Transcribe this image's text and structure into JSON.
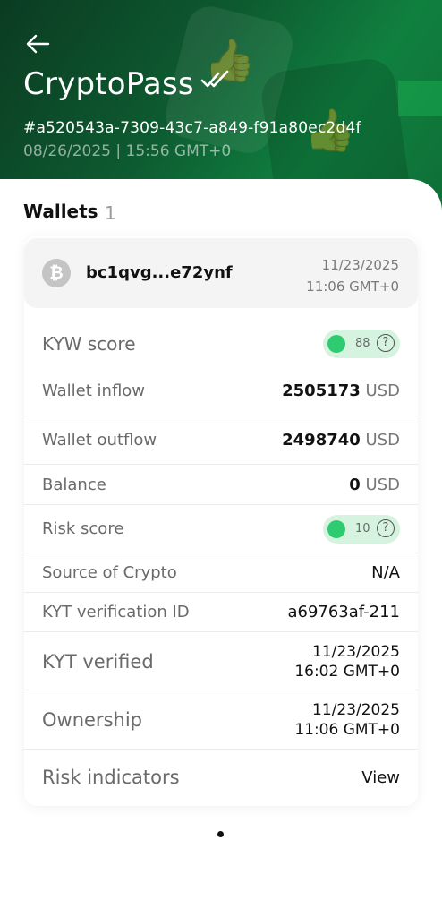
{
  "header": {
    "title": "CryptoPass",
    "hash": "#a520543a-7309-43c7-a849-f91a80ec2d4f",
    "timestamp": "08/26/2025 | 15:56 GMT+0"
  },
  "wallets": {
    "title": "Wallets",
    "count": "1",
    "item": {
      "icon": "bitcoin-icon",
      "icon_glyph": "₿",
      "address": "bc1qvg...e72ynf",
      "date": "11/23/2025",
      "time": "11:06 GMT+0"
    }
  },
  "details": {
    "kyw_score": {
      "label": "KYW score",
      "value": "88",
      "help": "?"
    },
    "inflow": {
      "label": "Wallet inflow",
      "amount": "2505173",
      "unit": "USD"
    },
    "outflow": {
      "label": "Wallet outflow",
      "amount": "2498740",
      "unit": "USD"
    },
    "balance": {
      "label": "Balance",
      "amount": "0",
      "unit": "USD"
    },
    "risk_score": {
      "label": "Risk score",
      "value": "10",
      "help": "?"
    },
    "source": {
      "label": "Source of Crypto",
      "value": "N/A"
    },
    "kyt_id": {
      "label": "KYT verification ID",
      "value": "a69763af-211"
    },
    "kyt_verified": {
      "label": "KYT verified",
      "date": "11/23/2025",
      "time": "16:02 GMT+0"
    },
    "ownership": {
      "label": "Ownership",
      "date": "11/23/2025",
      "time": "11:06 GMT+0"
    },
    "risk_indicators": {
      "label": "Risk indicators",
      "link": "View"
    }
  },
  "colors": {
    "accent": "#1fae5c",
    "header_dark": "#0b3b22",
    "score_green": "#2ecc71"
  }
}
